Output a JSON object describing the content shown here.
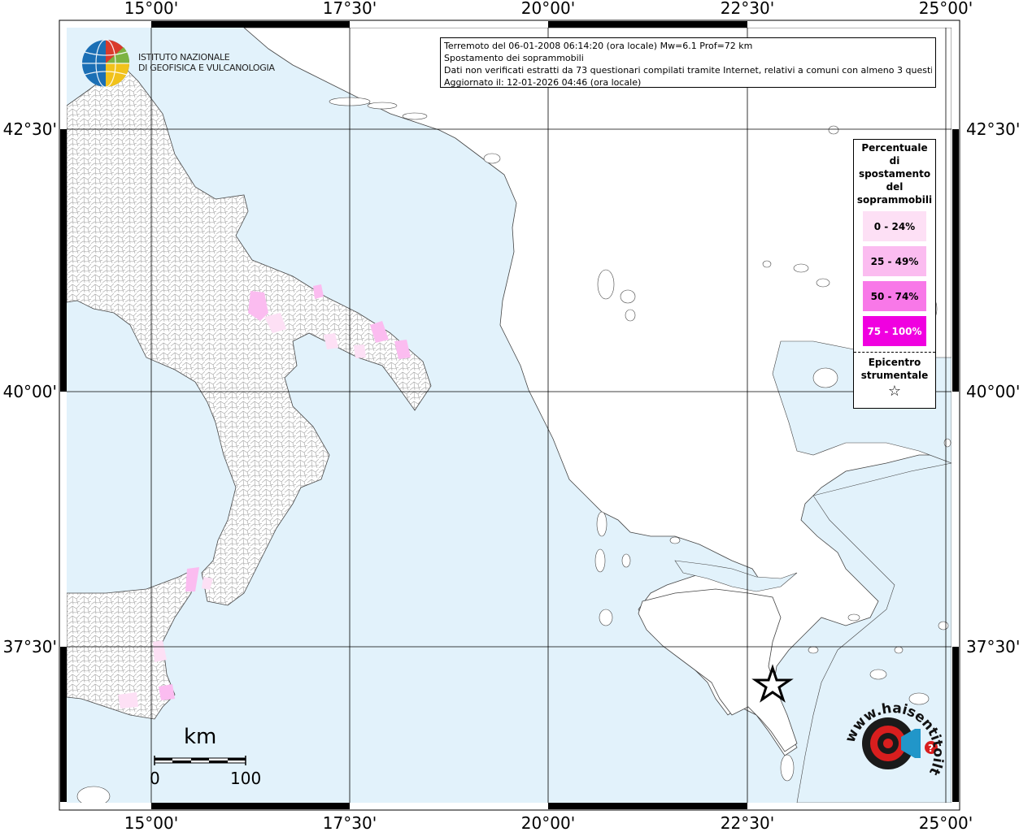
{
  "header": {
    "line1": "Terremoto del 06-01-2008 06:14:20 (ora locale) Mw=6.1 Prof=72 km",
    "line2": "Spostamento dei soprammobili",
    "line3": "Dati non verificati estratti da 73 questionari compilati tramite Internet, relativi a comuni con almeno 3 questionari.",
    "line4": "Aggiornato il: 12-01-2026 04:46 (ora locale)"
  },
  "institute": {
    "line1": "ISTITUTO NAZIONALE",
    "line2": "DI GEOFISICA E VULCANOLOGIA"
  },
  "axes": {
    "lon_labels": [
      "15°00'",
      "17°30'",
      "20°00'",
      "22°30'",
      "25°00'"
    ],
    "lat_labels": [
      "42°30'",
      "40°00'",
      "37°30'"
    ]
  },
  "legend": {
    "title_lines": [
      "Percentuale",
      "di",
      "spostamento",
      "del",
      "soprammobili"
    ],
    "items": [
      {
        "label": "0 - 24%",
        "color": "#fde0f5"
      },
      {
        "label": "25 - 49%",
        "color": "#fbbcf0"
      },
      {
        "label": "50 - 74%",
        "color": "#f878e8"
      },
      {
        "label": "75 - 100%",
        "color": "#f000e0",
        "text_color": "#ffffff"
      }
    ],
    "epicenter_lines": [
      "Epicentro",
      "strumentale"
    ],
    "epicenter_symbol": "☆"
  },
  "scale_bar": {
    "unit": "km",
    "start": "0",
    "end": "100"
  },
  "colors": {
    "sea": "#e2f2fb",
    "land": "#ffffff",
    "borders": "#555555"
  },
  "watermark": {
    "text": "www.haisentitoilterremoto.it"
  }
}
